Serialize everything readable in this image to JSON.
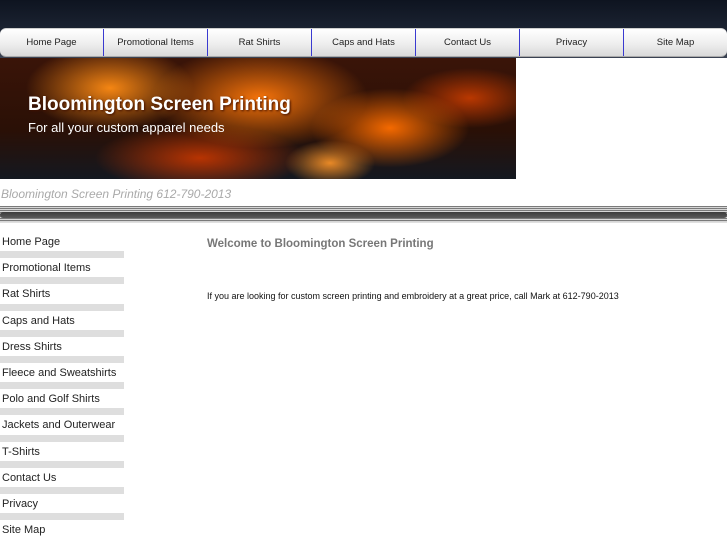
{
  "top_nav": {
    "items": [
      {
        "label": "Home Page"
      },
      {
        "label": "Promotional Items"
      },
      {
        "label": "Rat Shirts"
      },
      {
        "label": "Caps and Hats"
      },
      {
        "label": "Contact Us"
      },
      {
        "label": "Privacy"
      },
      {
        "label": "Site Map"
      }
    ]
  },
  "banner": {
    "title": "Bloomington Screen Printing",
    "tagline": "For all your custom apparel needs"
  },
  "subtitle": "Bloomington Screen Printing  612-790-2013",
  "sidebar": {
    "items": [
      {
        "label": "Home Page"
      },
      {
        "label": "Promotional Items"
      },
      {
        "label": "Rat Shirts"
      },
      {
        "label": "Caps and Hats"
      },
      {
        "label": "Dress Shirts"
      },
      {
        "label": "Fleece and Sweatshirts"
      },
      {
        "label": "Polo and Golf Shirts"
      },
      {
        "label": "Jackets and Outerwear"
      },
      {
        "label": "T-Shirts"
      },
      {
        "label": "Contact Us"
      },
      {
        "label": "Privacy"
      },
      {
        "label": "Site Map"
      }
    ]
  },
  "main": {
    "heading": "Welcome to Bloomington Screen Printing",
    "intro": "If you are looking for custom screen printing and embroidery at a great price, call Mark at 612-790-2013"
  }
}
